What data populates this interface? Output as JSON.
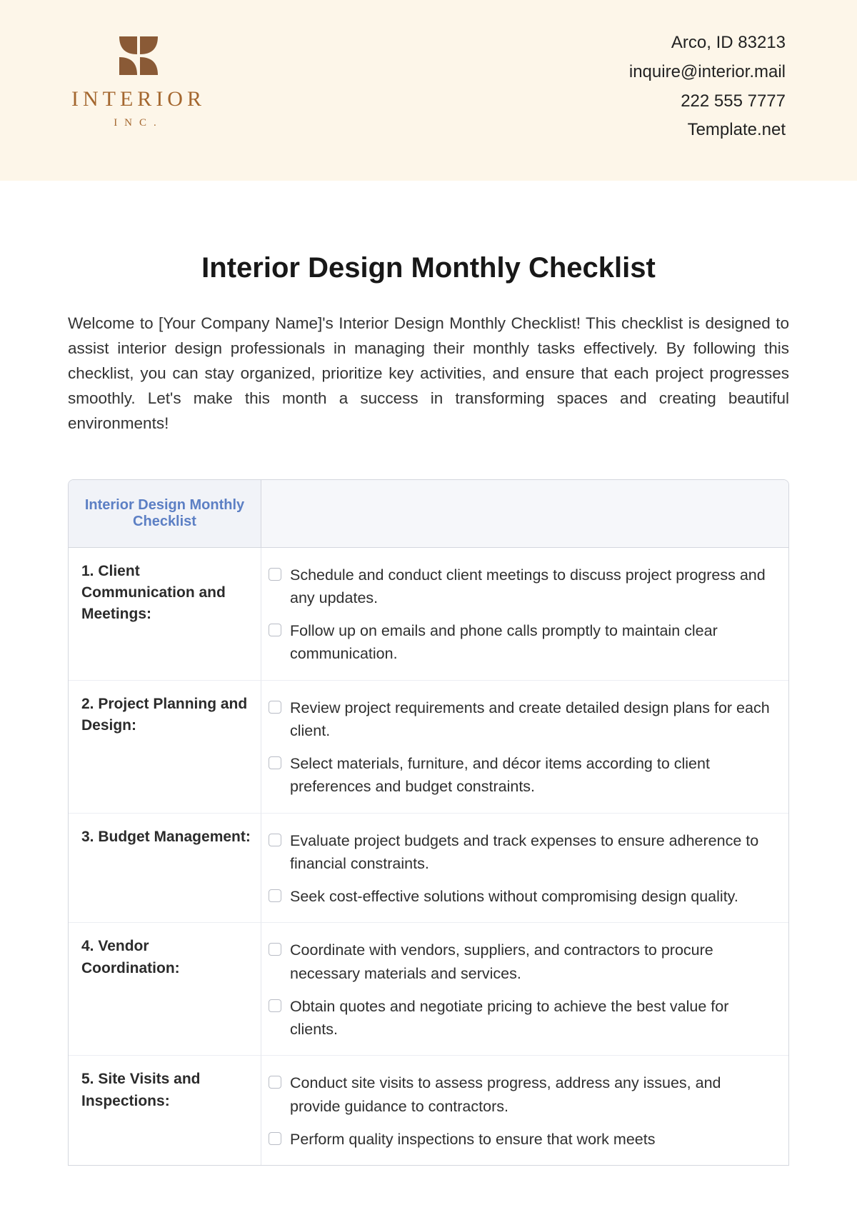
{
  "header": {
    "logo": {
      "word": "INTERIOR",
      "inc": "INC."
    },
    "contact": {
      "address": "Arco, ID 83213",
      "email": "inquire@interior.mail",
      "phone": "222 555 7777",
      "site": "Template.net"
    }
  },
  "title": "Interior Design Monthly Checklist",
  "intro": "Welcome to [Your Company Name]'s Interior Design Monthly Checklist! This checklist is designed to assist interior design professionals in managing their monthly tasks effectively. By following this checklist, you can stay organized, prioritize key activities, and ensure that each project progresses smoothly. Let's make this month a success in transforming spaces and creating beautiful environments!",
  "table": {
    "header_left": "Interior Design Monthly Checklist",
    "rows": [
      {
        "category": "1. Client Communication and Meetings:",
        "items": [
          "Schedule and conduct client meetings to discuss project progress and any updates.",
          "Follow up on emails and phone calls promptly to maintain clear communication."
        ]
      },
      {
        "category": "2. Project Planning and Design:",
        "items": [
          "Review project requirements and create detailed design plans for each client.",
          "Select materials, furniture, and décor items according to client preferences and budget constraints."
        ]
      },
      {
        "category": "3. Budget Management:",
        "items": [
          "Evaluate project budgets and track expenses to ensure adherence to financial constraints.",
          "Seek cost-effective solutions without compromising design quality."
        ]
      },
      {
        "category": "4. Vendor Coordination:",
        "items": [
          "Coordinate with vendors, suppliers, and contractors to procure necessary materials and services.",
          "Obtain quotes and negotiate pricing to achieve the best value for clients."
        ]
      },
      {
        "category": "5. Site Visits and Inspections:",
        "items": [
          "Conduct site visits to assess progress, address any issues, and provide guidance to contractors.",
          "Perform quality inspections to ensure that work meets"
        ]
      }
    ]
  }
}
